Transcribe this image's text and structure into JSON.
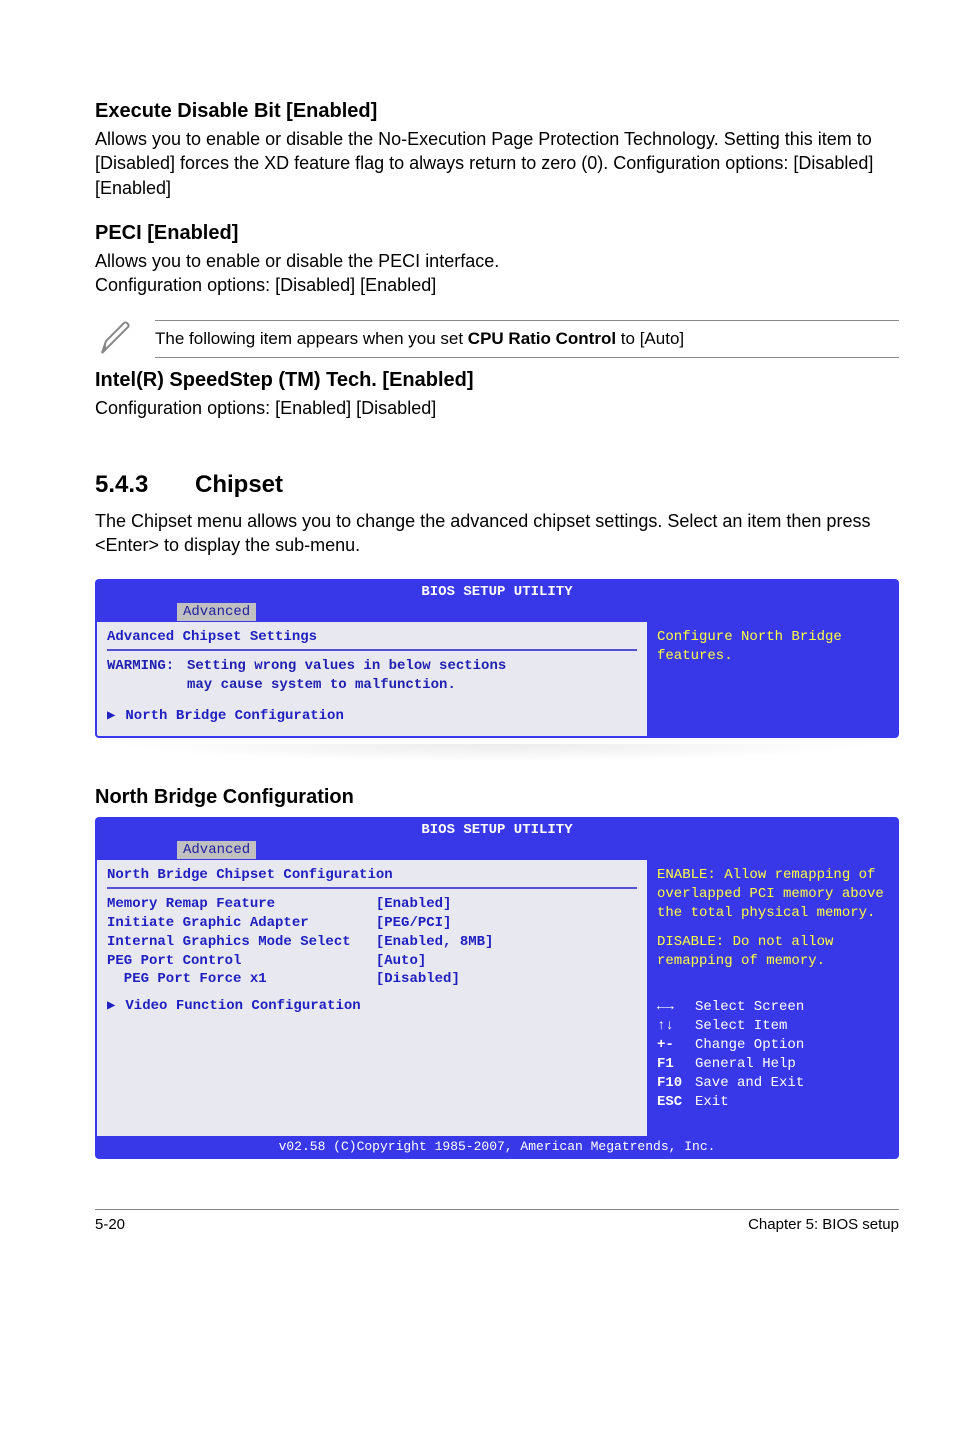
{
  "sections": {
    "exec_disable": {
      "title": "Execute Disable Bit [Enabled]",
      "body": "Allows you to enable or disable the No-Execution Page Protection Technology. Setting this item to [Disabled] forces the XD feature flag to always return to zero (0). Configuration options: [Disabled] [Enabled]"
    },
    "peci": {
      "title": "PECI [Enabled]",
      "body": "Allows you to enable or disable the PECI interface.\nConfiguration options: [Disabled] [Enabled]"
    },
    "note": {
      "prefix": "The following item appears when you set ",
      "bold": "CPU Ratio Control",
      "suffix": " to [Auto]"
    },
    "speedstep": {
      "title": "Intel(R) SpeedStep (TM) Tech. [Enabled]",
      "body": "Configuration options: [Enabled] [Disabled]"
    },
    "chipset_heading": {
      "num": "5.4.3",
      "title": "Chipset"
    },
    "chipset_body": "The Chipset menu allows you to change the advanced chipset settings. Select an item then press <Enter> to display the sub-menu.",
    "north_bridge_heading": "North Bridge Configuration"
  },
  "bios1": {
    "title": "BIOS SETUP UTILITY",
    "tab": "Advanced",
    "heading": "Advanced Chipset Settings",
    "warning_label": "WARMING:",
    "warning_text1": "Setting wrong values in below sections",
    "warning_text2": "may cause system to malfunction.",
    "menu_item": "North Bridge Configuration",
    "help": "Configure North Bridge features."
  },
  "bios2": {
    "title": "BIOS SETUP UTILITY",
    "tab": "Advanced",
    "heading": "North Bridge Chipset Configuration",
    "rows": [
      {
        "label": "Memory Remap Feature",
        "value": "[Enabled]"
      },
      {
        "label": "Initiate Graphic Adapter",
        "value": "[PEG/PCI]"
      },
      {
        "label": "Internal Graphics Mode Select",
        "value": "[Enabled, 8MB]"
      },
      {
        "label": "PEG Port Control",
        "value": "[Auto]"
      },
      {
        "label": "  PEG Port Force x1",
        "value": "[Disabled]"
      }
    ],
    "submenu": "Video Function Configuration",
    "help1": "ENABLE: Allow remapping of overlapped PCI memory above the total physical memory.",
    "help2": "DISABLE: Do not allow remapping of memory.",
    "keys": [
      {
        "k": "←→",
        "d": "Select Screen"
      },
      {
        "k": "↑↓",
        "d": "Select Item"
      },
      {
        "k": "+-",
        "d": "Change Option"
      },
      {
        "k": "F1",
        "d": "General Help"
      },
      {
        "k": "F10",
        "d": "Save and Exit"
      },
      {
        "k": "ESC",
        "d": "Exit"
      }
    ],
    "footer": "v02.58 (C)Copyright 1985-2007, American Megatrends, Inc."
  },
  "footer": {
    "left": "5-20",
    "right": "Chapter 5: BIOS setup"
  }
}
